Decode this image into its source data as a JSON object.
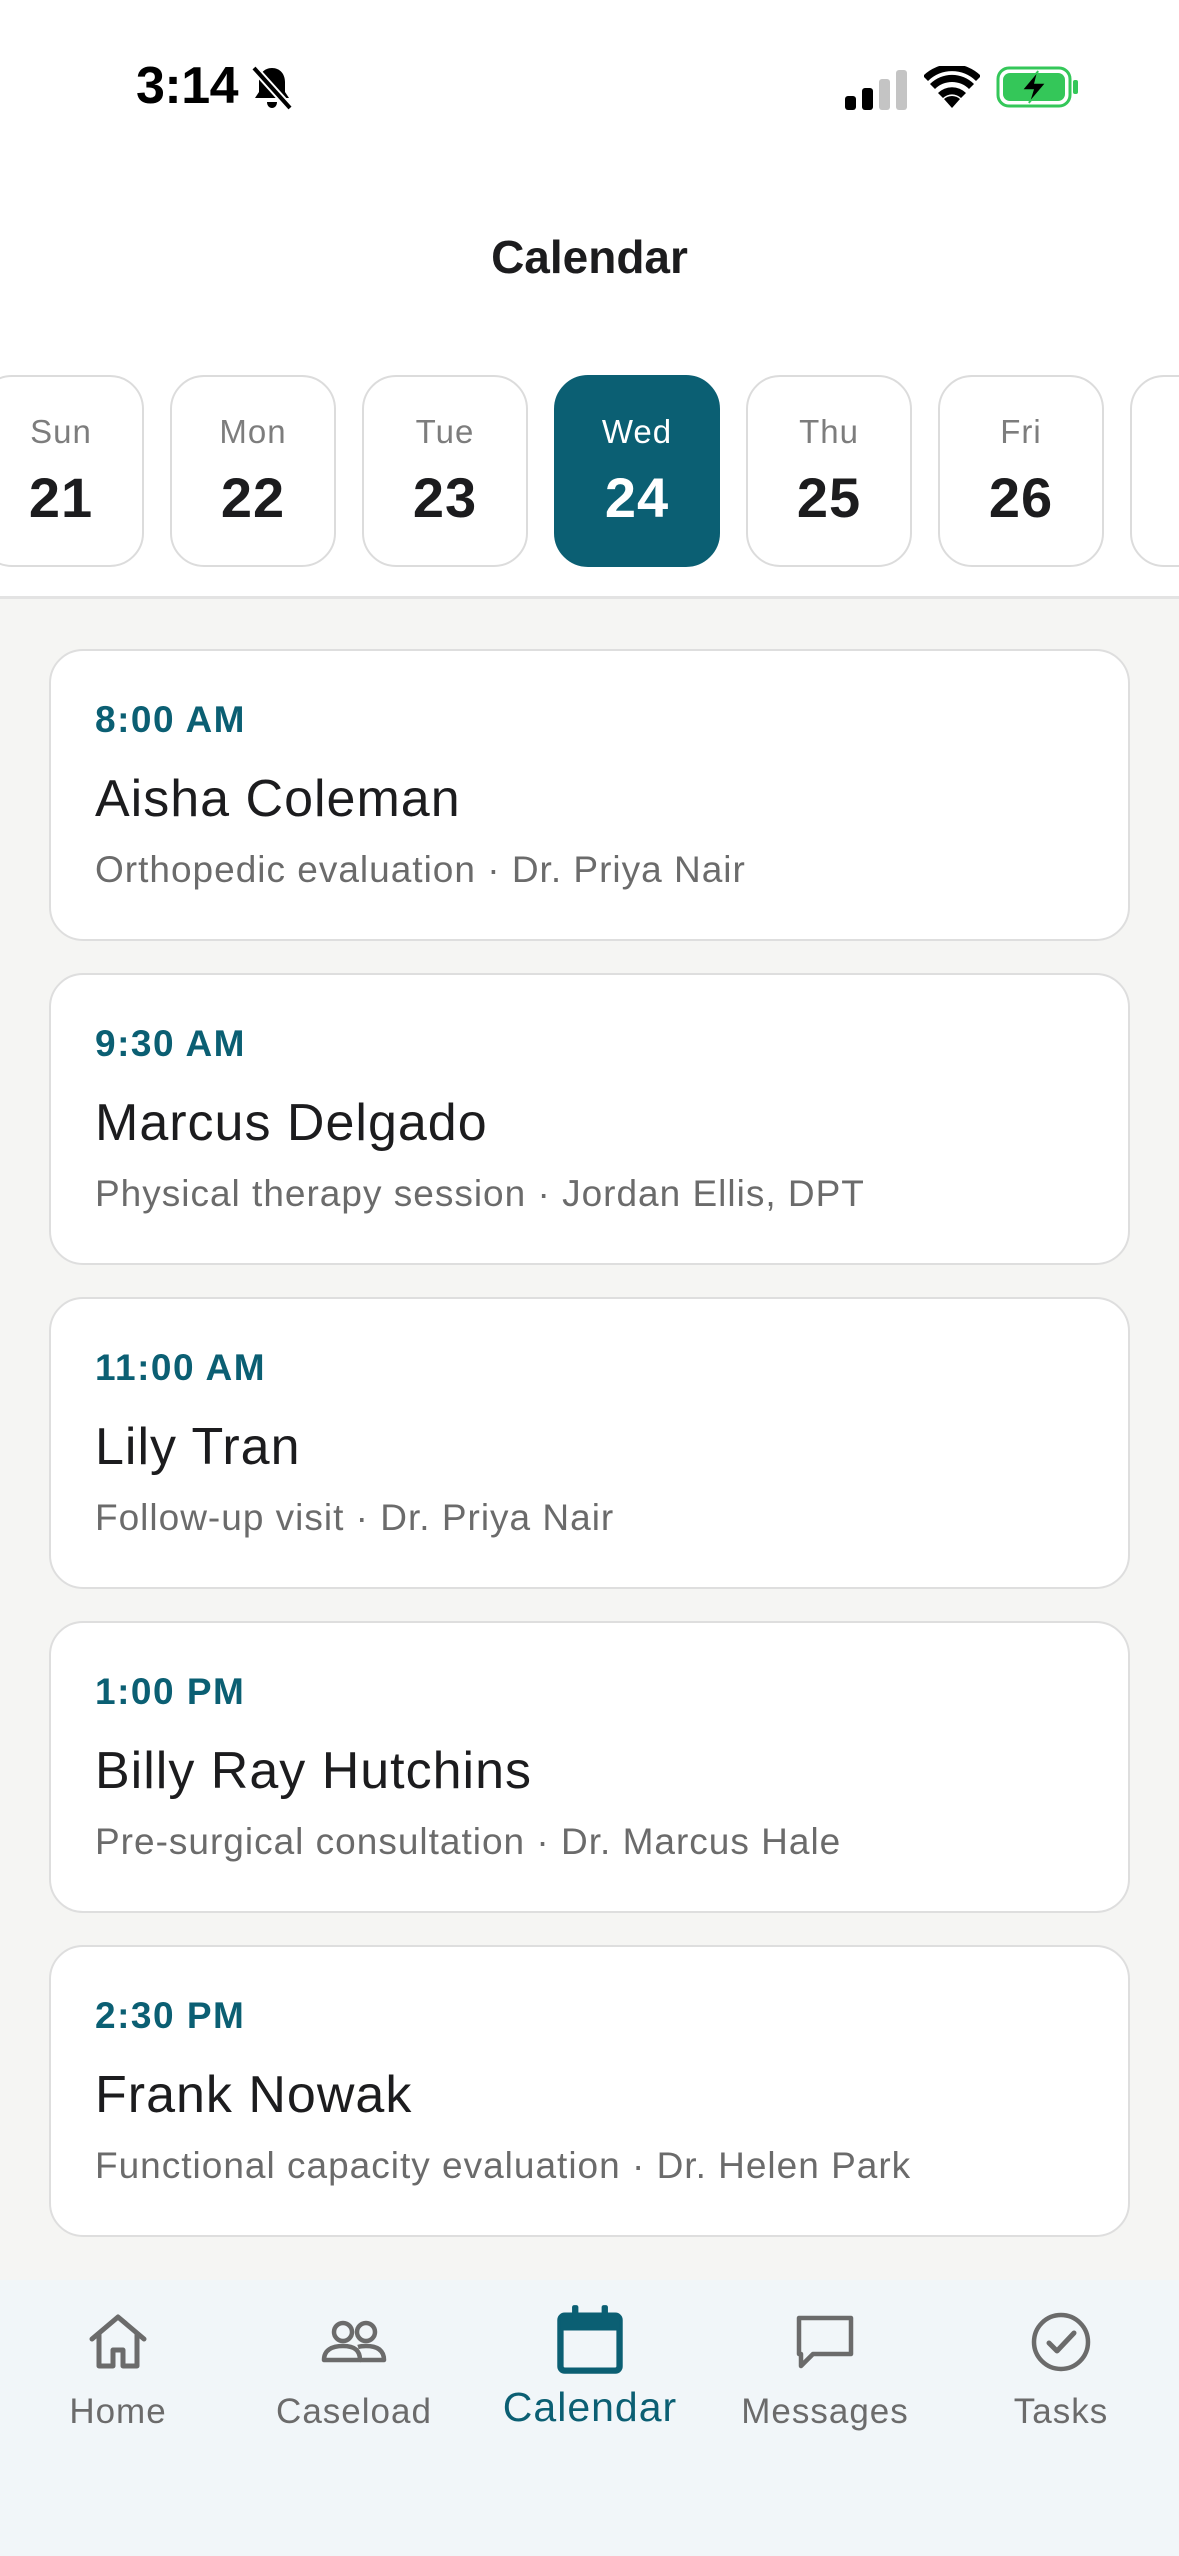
{
  "status_bar": {
    "time": "3:14"
  },
  "header": {
    "title": "Calendar"
  },
  "date_strip": {
    "days": [
      {
        "dow": "Sun",
        "num": "21",
        "selected": false
      },
      {
        "dow": "Mon",
        "num": "22",
        "selected": false
      },
      {
        "dow": "Tue",
        "num": "23",
        "selected": false
      },
      {
        "dow": "Wed",
        "num": "24",
        "selected": true
      },
      {
        "dow": "Thu",
        "num": "25",
        "selected": false
      },
      {
        "dow": "Fri",
        "num": "26",
        "selected": false
      },
      {
        "dow": "",
        "num": "",
        "selected": false
      }
    ]
  },
  "appointments": [
    {
      "time": "8:00 AM",
      "name": "Aisha Coleman",
      "detail": "Orthopedic evaluation · Dr. Priya Nair"
    },
    {
      "time": "9:30 AM",
      "name": "Marcus Delgado",
      "detail": "Physical therapy session · Jordan Ellis, DPT"
    },
    {
      "time": "11:00 AM",
      "name": "Lily Tran",
      "detail": "Follow-up visit · Dr. Priya Nair"
    },
    {
      "time": "1:00 PM",
      "name": "Billy Ray Hutchins",
      "detail": "Pre-surgical consultation · Dr. Marcus Hale"
    },
    {
      "time": "2:30 PM",
      "name": "Frank Nowak",
      "detail": "Functional capacity evaluation · Dr. Helen Park"
    }
  ],
  "tab_bar": {
    "items": [
      {
        "label": "Home",
        "icon": "home-icon",
        "active": false
      },
      {
        "label": "Caseload",
        "icon": "people-icon",
        "active": false
      },
      {
        "label": "Calendar",
        "icon": "calendar-icon",
        "active": true
      },
      {
        "label": "Messages",
        "icon": "message-icon",
        "active": false
      },
      {
        "label": "Tasks",
        "icon": "check-circle-icon",
        "active": false
      }
    ]
  },
  "colors": {
    "accent": "#0b5f73",
    "list_background": "#f5f5f3",
    "tab_bar_background": "#f1f6f9",
    "battery_fill": "#34c759"
  }
}
